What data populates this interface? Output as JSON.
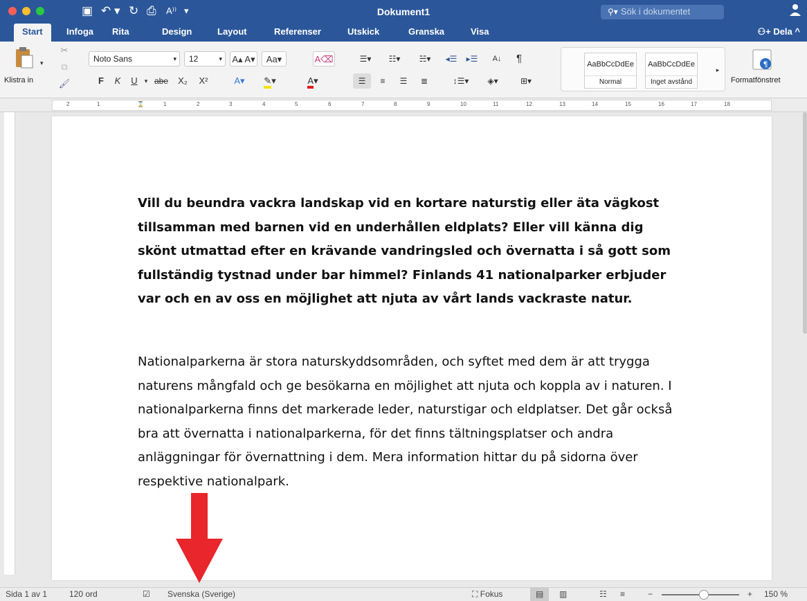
{
  "window": {
    "title": "Dokument1",
    "search_placeholder": "Sök i dokumentet"
  },
  "tabs": [
    "Start",
    "Infoga",
    "Rita",
    "Design",
    "Layout",
    "Referenser",
    "Utskick",
    "Granska",
    "Visa"
  ],
  "share_label": "Dela",
  "ribbon": {
    "paste_label": "Klistra in",
    "font_name": "Noto Sans",
    "font_size": "12",
    "bold": "F",
    "italic": "K",
    "underline": "U",
    "strike": "abe",
    "subscript": "X₂",
    "superscript": "X²",
    "styles": [
      {
        "preview": "AaBbCcDdEe",
        "name": "Normal"
      },
      {
        "preview": "AaBbCcDdEe",
        "name": "Inget avstånd"
      }
    ],
    "format_pane_label": "Formatfönstret"
  },
  "ruler_numbers": [
    "2",
    "1",
    "1",
    "2",
    "3",
    "4",
    "5",
    "6",
    "7",
    "8",
    "9",
    "10",
    "11",
    "12",
    "13",
    "14",
    "15",
    "16",
    "17",
    "18"
  ],
  "document": {
    "paragraph1": "Vill du beundra vackra landskap vid en kortare naturstig eller äta vägkost tillsamman med barnen vid en underhållen eldplats? Eller vill känna dig skönt utmattad efter en krävande vandringsled och övernatta i så gott som fullständig tystnad under bar himmel? Finlands 41 nationalparker erbjuder var och en av oss en möjlighet att njuta av vårt lands vackraste natur.",
    "paragraph2": "Nationalparkerna är stora naturskyddsområden, och syftet med dem är att trygga naturens mångfald och ge besökarna en möjlighet att njuta och koppla av i naturen. I nationalparkerna finns det markerade leder, naturstigar och eldplatser. Det går också bra att övernatta i nationalparkerna, för det finns tältningsplatser och andra anläggningar för övernattning i dem. Mera information hittar du på sidorna över respektive nationalpark."
  },
  "status": {
    "page": "Sida 1 av 1",
    "words": "120 ord",
    "language": "Svenska (Sverige)",
    "focus": "Fokus",
    "zoom": "150 %",
    "zoom_level_percent": 150
  },
  "colors": {
    "brand_blue": "#2b579a",
    "arrow_red": "#e8262b"
  }
}
